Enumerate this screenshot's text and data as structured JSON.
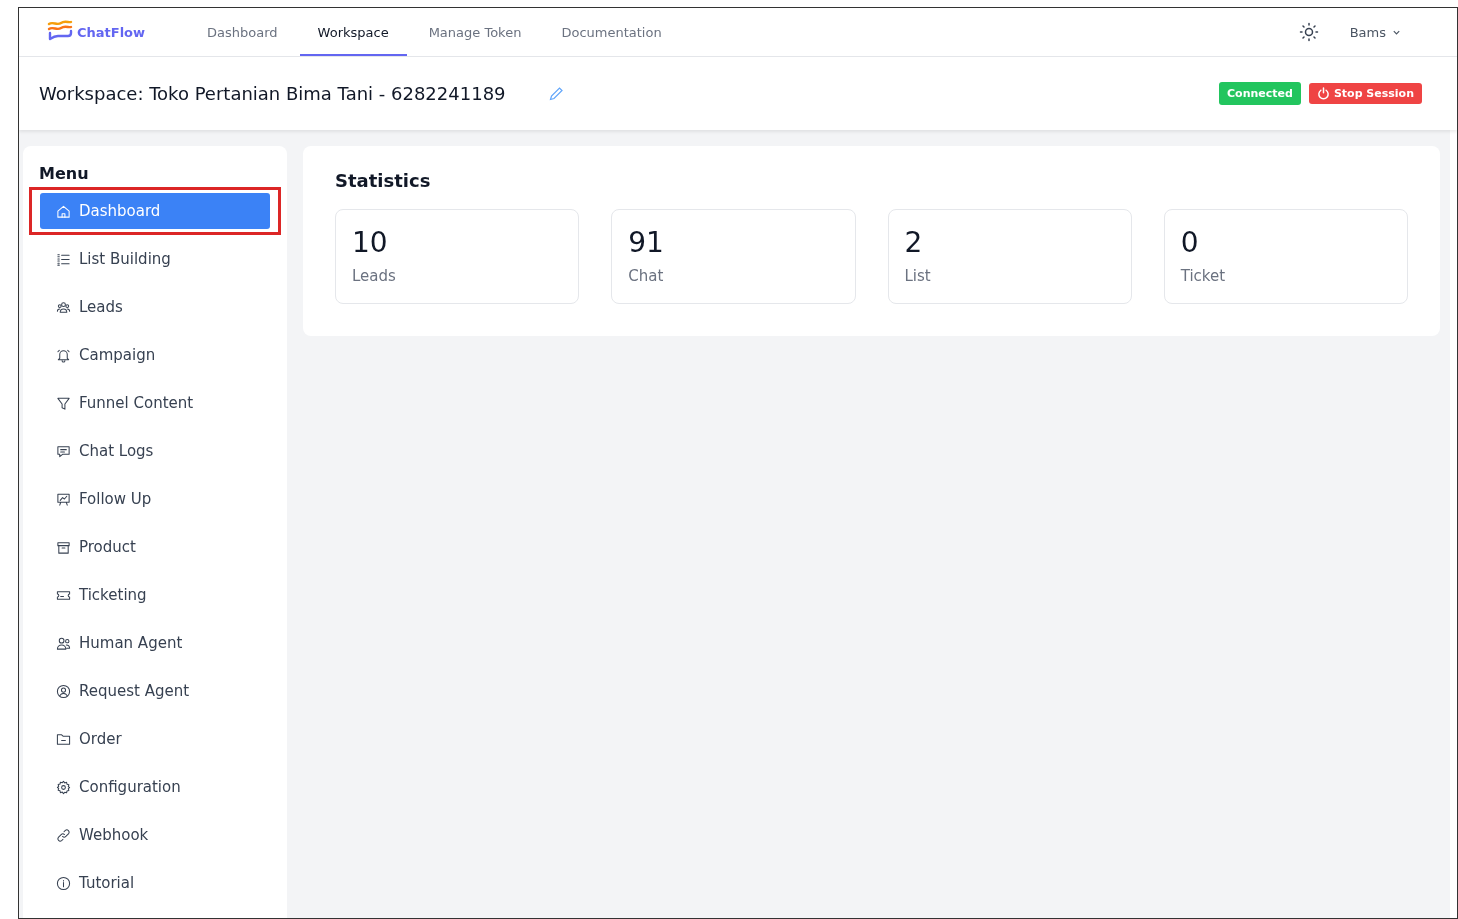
{
  "brand": {
    "name": "ChatFlow"
  },
  "nav": [
    {
      "label": "Dashboard",
      "selected": false
    },
    {
      "label": "Workspace",
      "selected": true
    },
    {
      "label": "Manage Token",
      "selected": false
    },
    {
      "label": "Documentation",
      "selected": false
    }
  ],
  "user": {
    "name": "Bams"
  },
  "workspace": {
    "title": "Workspace: Toko Pertanian Bima Tani - 6282241189",
    "status": "Connected",
    "stop_button": "Stop Session"
  },
  "menu": {
    "title": "Menu",
    "items": [
      {
        "label": "Dashboard",
        "selected": true,
        "highlighted": true
      },
      {
        "label": "List Building",
        "selected": false,
        "highlighted": false
      },
      {
        "label": "Leads",
        "selected": false,
        "highlighted": false
      },
      {
        "label": "Campaign",
        "selected": false,
        "highlighted": false
      },
      {
        "label": "Funnel Content",
        "selected": false,
        "highlighted": false
      },
      {
        "label": "Chat Logs",
        "selected": false,
        "highlighted": false
      },
      {
        "label": "Follow Up",
        "selected": false,
        "highlighted": false
      },
      {
        "label": "Product",
        "selected": false,
        "highlighted": false
      },
      {
        "label": "Ticketing",
        "selected": false,
        "highlighted": false
      },
      {
        "label": "Human Agent",
        "selected": false,
        "highlighted": false
      },
      {
        "label": "Request Agent",
        "selected": false,
        "highlighted": false
      },
      {
        "label": "Order",
        "selected": false,
        "highlighted": false
      },
      {
        "label": "Configuration",
        "selected": false,
        "highlighted": false
      },
      {
        "label": "Webhook",
        "selected": false,
        "highlighted": false
      },
      {
        "label": "Tutorial",
        "selected": false,
        "highlighted": false
      }
    ]
  },
  "statistics": {
    "title": "Statistics",
    "cards": [
      {
        "value": "10",
        "label": "Leads"
      },
      {
        "value": "91",
        "label": "Chat"
      },
      {
        "value": "2",
        "label": "List"
      },
      {
        "value": "0",
        "label": "Ticket"
      }
    ]
  }
}
